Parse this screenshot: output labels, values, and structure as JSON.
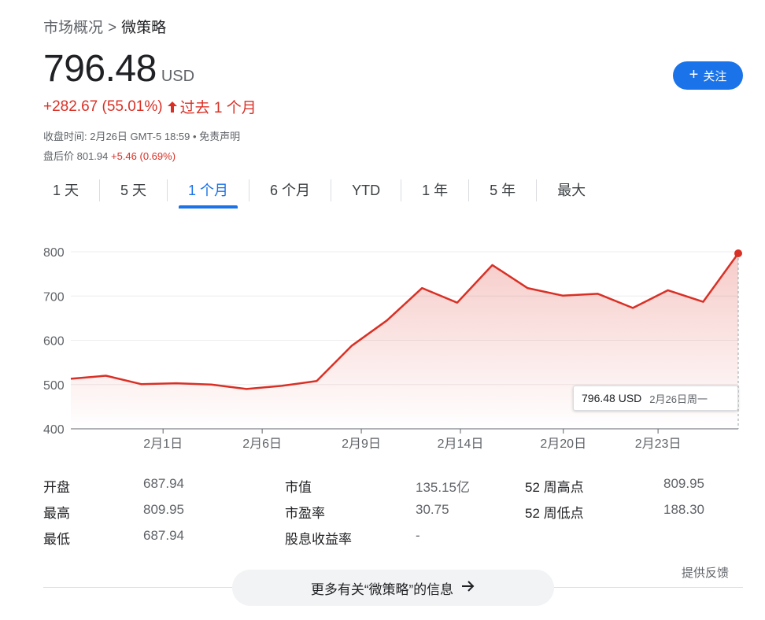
{
  "breadcrumb": {
    "parent": "市场概况",
    "separator": ">",
    "current": "微策略"
  },
  "quote": {
    "price": "796.48",
    "currency": "USD",
    "change": "+282.67 (55.01%)",
    "change_period": "过去 1 个月",
    "close_info": "收盘时间: 2月26日 GMT-5 18:59 • ",
    "disclaimer": "免责声明",
    "after_hours_label": "盘后价 801.94",
    "after_hours_change": "+5.46 (0.69%)"
  },
  "follow_button": {
    "label": "关注"
  },
  "tabs": [
    {
      "label": "1 天",
      "active": false
    },
    {
      "label": "5 天",
      "active": false
    },
    {
      "label": "1 个月",
      "active": true
    },
    {
      "label": "6 个月",
      "active": false
    },
    {
      "label": "YTD",
      "active": false
    },
    {
      "label": "1 年",
      "active": false
    },
    {
      "label": "5 年",
      "active": false
    },
    {
      "label": "最大",
      "active": false
    }
  ],
  "chart_data": {
    "type": "area",
    "x_labels": [
      "2月1日",
      "2月6日",
      "2月9日",
      "2月14日",
      "2月20日",
      "2月23日"
    ],
    "y_ticks": [
      400,
      500,
      600,
      700,
      800
    ],
    "ylim": [
      400,
      800
    ],
    "values": [
      513,
      520,
      501,
      503,
      500,
      490,
      497,
      508,
      588,
      645,
      718,
      685,
      770,
      718,
      701,
      705,
      673,
      713,
      687,
      796.48
    ],
    "color": "#d93025",
    "tooltip": {
      "value": "796.48 USD",
      "date": "2月26日周一"
    }
  },
  "stats": {
    "col1": [
      {
        "label": "开盘",
        "value": "687.94"
      },
      {
        "label": "最高",
        "value": "809.95"
      },
      {
        "label": "最低",
        "value": "687.94"
      }
    ],
    "col2": [
      {
        "label": "市值",
        "value": "135.15亿"
      },
      {
        "label": "市盈率",
        "value": "30.75"
      },
      {
        "label": "股息收益率",
        "value": "-"
      }
    ],
    "col3": [
      {
        "label": "52 周高点",
        "value": "809.95"
      },
      {
        "label": "52 周低点",
        "value": "188.30"
      }
    ]
  },
  "feedback": "提供反馈",
  "more_button": {
    "label": "更多有关“微策略”的信息"
  }
}
